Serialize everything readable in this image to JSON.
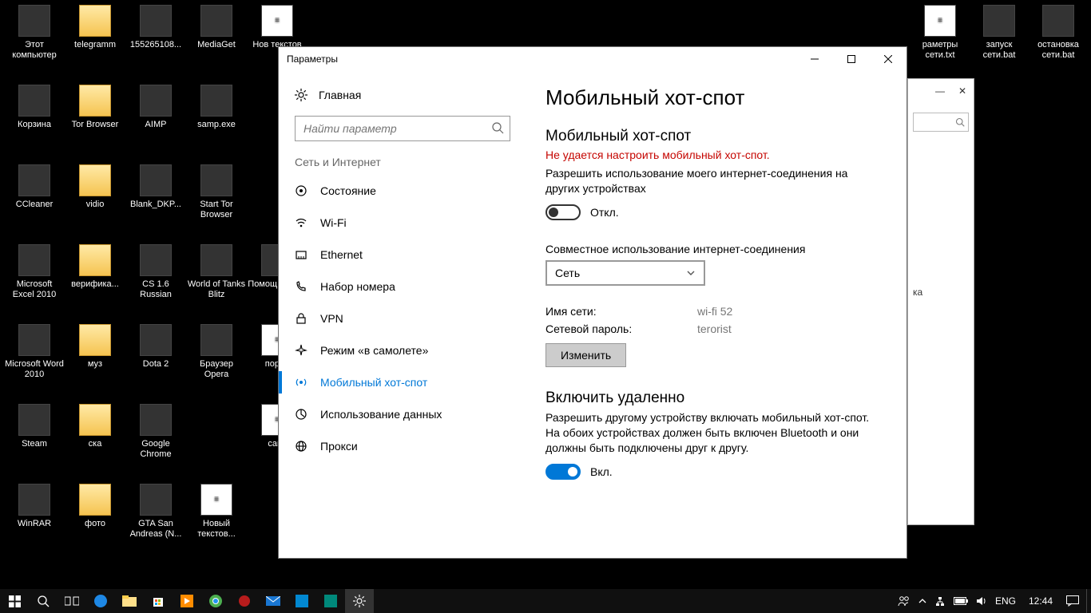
{
  "desktop_icons": [
    {
      "label": "Этот компьютер",
      "kind": "generic",
      "col": 0,
      "row": 0
    },
    {
      "label": "Корзина",
      "kind": "generic",
      "col": 0,
      "row": 1
    },
    {
      "label": "CCleaner",
      "kind": "generic",
      "col": 0,
      "row": 2
    },
    {
      "label": "Microsoft Excel 2010",
      "kind": "generic",
      "col": 0,
      "row": 3
    },
    {
      "label": "Microsoft Word 2010",
      "kind": "generic",
      "col": 0,
      "row": 4
    },
    {
      "label": "Steam",
      "kind": "generic",
      "col": 0,
      "row": 5
    },
    {
      "label": "WinRAR",
      "kind": "generic",
      "col": 0,
      "row": 6
    },
    {
      "label": "telegramm",
      "kind": "folder",
      "col": 1,
      "row": 0
    },
    {
      "label": "Tor Browser",
      "kind": "folder",
      "col": 1,
      "row": 1
    },
    {
      "label": "vidio",
      "kind": "folder",
      "col": 1,
      "row": 2
    },
    {
      "label": "верифика...",
      "kind": "folder",
      "col": 1,
      "row": 3
    },
    {
      "label": "муз",
      "kind": "folder",
      "col": 1,
      "row": 4
    },
    {
      "label": "ска",
      "kind": "folder",
      "col": 1,
      "row": 5
    },
    {
      "label": "фото",
      "kind": "folder",
      "col": 1,
      "row": 6
    },
    {
      "label": "155265108...",
      "kind": "generic",
      "col": 2,
      "row": 0
    },
    {
      "label": "AIMP",
      "kind": "generic",
      "col": 2,
      "row": 1
    },
    {
      "label": "Blank_DKP...",
      "kind": "generic",
      "col": 2,
      "row": 2
    },
    {
      "label": "CS 1.6 Russian",
      "kind": "generic",
      "col": 2,
      "row": 3
    },
    {
      "label": "Dota 2",
      "kind": "generic",
      "col": 2,
      "row": 4
    },
    {
      "label": "Google Chrome",
      "kind": "generic",
      "col": 2,
      "row": 5
    },
    {
      "label": "GTA San Andreas (N...",
      "kind": "generic",
      "col": 2,
      "row": 6
    },
    {
      "label": "MediaGet",
      "kind": "generic",
      "col": 3,
      "row": 0
    },
    {
      "label": "samp.exe",
      "kind": "generic",
      "col": 3,
      "row": 1
    },
    {
      "label": "Start Tor Browser",
      "kind": "generic",
      "col": 3,
      "row": 2
    },
    {
      "label": "World of Tanks Blitz",
      "kind": "generic",
      "col": 3,
      "row": 3
    },
    {
      "label": "Браузер Opera",
      "kind": "generic",
      "col": 3,
      "row": 4
    },
    {
      "label": "Новый текстов...",
      "kind": "txt",
      "col": 3,
      "row": 6
    },
    {
      "label": "Нов текстов",
      "kind": "txt",
      "col": 4,
      "row": 0
    },
    {
      "label": "Помощ по обн",
      "kind": "generic",
      "col": 4,
      "row": 3
    },
    {
      "label": "порол",
      "kind": "txt",
      "col": 4,
      "row": 4
    },
    {
      "label": "самг",
      "kind": "txt",
      "col": 4,
      "row": 5
    },
    {
      "label": "раметры сети.txt",
      "kind": "txt",
      "col": 15,
      "row": 0
    },
    {
      "label": "запуск сети.bat",
      "kind": "generic",
      "col": 16,
      "row": 0
    },
    {
      "label": "остановка сети.bat",
      "kind": "generic",
      "col": 17,
      "row": 0
    }
  ],
  "settings": {
    "window_title": "Параметры",
    "sidebar": {
      "home": "Главная",
      "search_placeholder": "Найти параметр",
      "category": "Сеть и Интернет",
      "items": [
        {
          "label": "Состояние",
          "icon": "status"
        },
        {
          "label": "Wi-Fi",
          "icon": "wifi"
        },
        {
          "label": "Ethernet",
          "icon": "ethernet"
        },
        {
          "label": "Набор номера",
          "icon": "dialup"
        },
        {
          "label": "VPN",
          "icon": "vpn"
        },
        {
          "label": "Режим «в самолете»",
          "icon": "airplane"
        },
        {
          "label": "Мобильный хот-спот",
          "icon": "hotspot",
          "active": true
        },
        {
          "label": "Использование данных",
          "icon": "datausage"
        },
        {
          "label": "Прокси",
          "icon": "proxy"
        }
      ]
    },
    "main": {
      "title": "Мобильный хот-спот",
      "section1_heading": "Мобильный хот-спот",
      "error": "Не удается настроить мобильный хот-спот.",
      "share_desc": "Разрешить использование моего интернет-соединения на других устройствах",
      "toggle_off_label": "Откл.",
      "share_from_label": "Совместное использование интернет-соединения",
      "share_from_value": "Сеть",
      "net_name_label": "Имя сети:",
      "net_name_value": "wi-fi 52",
      "net_pass_label": "Сетевой пароль:",
      "net_pass_value": "terorist",
      "edit_btn": "Изменить",
      "section2_heading": "Включить удаленно",
      "remote_desc": "Разрешить другому устройству включать мобильный хот-спот. На обоих устройствах должен быть включен Bluetooth и они должны быть подключены друг к другу.",
      "toggle_on_label": "Вкл."
    }
  },
  "behind_window": {
    "partial_text": "ка"
  },
  "taskbar": {
    "lang": "ENG",
    "clock": "12:44"
  }
}
